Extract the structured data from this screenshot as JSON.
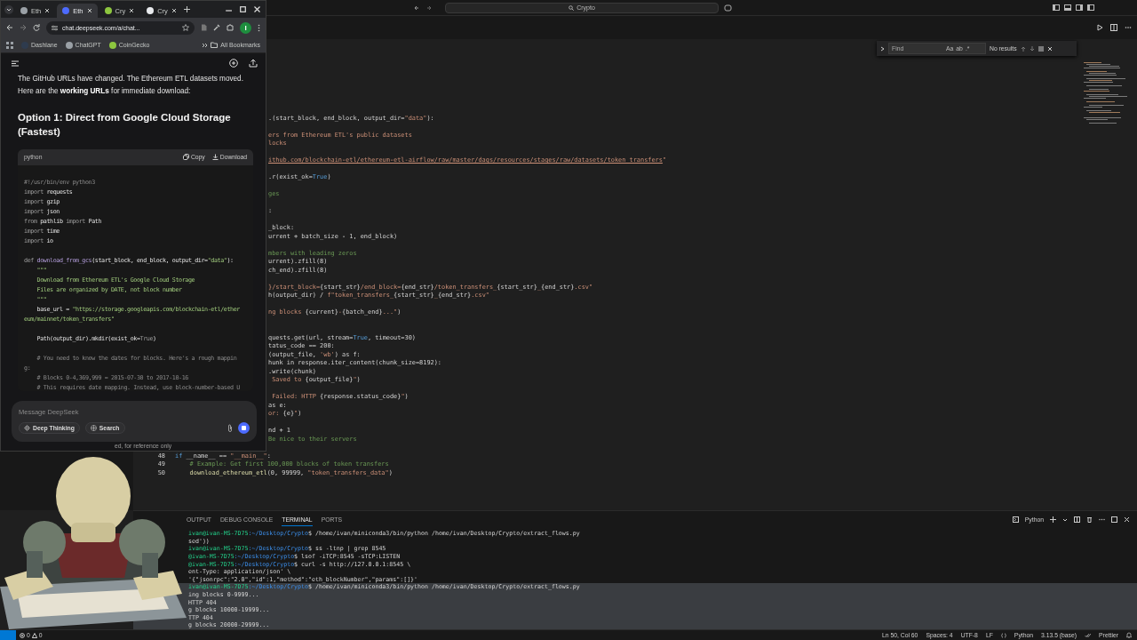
{
  "vscode": {
    "title": "Crypto",
    "find": {
      "placeholder": "Find",
      "options": [
        "Aa",
        "ab",
        ".*"
      ],
      "result": "No results"
    },
    "editor_lines": [
      {
        "kind": "blank"
      },
      {
        "kind": "blank"
      },
      {
        "kind": "blank"
      },
      {
        "kind": "blank"
      },
      {
        "kind": "blank"
      },
      {
        "kind": "blank"
      },
      {
        "kind": "blank"
      },
      {
        "kind": "cut",
        "segments": [
          {
            "kind": "plain",
            "text": ".(start_block, end_block, output_dir="
          },
          {
            "kind": "string",
            "text": "\"data\""
          },
          {
            "kind": "plain",
            "text": "):"
          }
        ]
      },
      {
        "kind": "blank"
      },
      {
        "kind": "cut",
        "segments": [
          {
            "kind": "string",
            "text": "ers from Ethereum ETL's public datasets"
          }
        ]
      },
      {
        "kind": "cut",
        "segments": [
          {
            "kind": "string",
            "text": "locks"
          }
        ]
      },
      {
        "kind": "blank"
      },
      {
        "kind": "cut",
        "segments": [
          {
            "kind": "link",
            "text": "ithub.com/blockchain-etl/ethereum-etl-airflow/raw/master/dags/resources/stages/raw/datasets/token_transfers"
          },
          {
            "kind": "string",
            "text": "\""
          }
        ]
      },
      {
        "kind": "blank"
      },
      {
        "kind": "cut",
        "segments": [
          {
            "kind": "plain",
            "text": ".r(exist_ok="
          },
          {
            "kind": "keyword",
            "text": "True"
          },
          {
            "kind": "plain",
            "text": ")"
          }
        ]
      },
      {
        "kind": "blank"
      },
      {
        "kind": "cut",
        "segments": [
          {
            "kind": "comment",
            "text": "ges"
          }
        ]
      },
      {
        "kind": "blank"
      },
      {
        "kind": "cut",
        "segments": [
          {
            "kind": "plain",
            "text": ":"
          }
        ]
      },
      {
        "kind": "blank"
      },
      {
        "kind": "cut",
        "segments": [
          {
            "kind": "plain",
            "text": "_block:"
          }
        ]
      },
      {
        "kind": "cut",
        "segments": [
          {
            "kind": "plain",
            "text": "urrent + batch_size - 1, end_block)"
          }
        ]
      },
      {
        "kind": "blank"
      },
      {
        "kind": "cut",
        "segments": [
          {
            "kind": "comment",
            "text": "mbers with leading zeros"
          }
        ]
      },
      {
        "kind": "cut",
        "segments": [
          {
            "kind": "plain",
            "text": "urrent).zfill(8)"
          }
        ]
      },
      {
        "kind": "cut",
        "segments": [
          {
            "kind": "plain",
            "text": "ch_end).zfill(8)"
          }
        ]
      },
      {
        "kind": "blank"
      },
      {
        "kind": "cut",
        "segments": [
          {
            "kind": "string",
            "text": "}/start_block="
          },
          {
            "kind": "plain",
            "text": "{start_str}"
          },
          {
            "kind": "string",
            "text": "/end_block="
          },
          {
            "kind": "plain",
            "text": "{end_str}"
          },
          {
            "kind": "string",
            "text": "/token_transfers_"
          },
          {
            "kind": "plain",
            "text": "{start_str}"
          },
          {
            "kind": "string",
            "text": "_"
          },
          {
            "kind": "plain",
            "text": "{end_str}"
          },
          {
            "kind": "string",
            "text": ".csv\""
          }
        ]
      },
      {
        "kind": "cut",
        "segments": [
          {
            "kind": "plain",
            "text": "h(output_dir) / "
          },
          {
            "kind": "string",
            "text": "f\"token_transfers_"
          },
          {
            "kind": "plain",
            "text": "{start_str}"
          },
          {
            "kind": "string",
            "text": "_"
          },
          {
            "kind": "plain",
            "text": "{end_str}"
          },
          {
            "kind": "string",
            "text": ".csv\""
          }
        ]
      },
      {
        "kind": "blank"
      },
      {
        "kind": "cut",
        "segments": [
          {
            "kind": "string",
            "text": "ng blocks "
          },
          {
            "kind": "plain",
            "text": "{current}"
          },
          {
            "kind": "string",
            "text": "-"
          },
          {
            "kind": "plain",
            "text": "{batch_end}"
          },
          {
            "kind": "string",
            "text": "...\""
          },
          {
            "kind": "plain",
            "text": ")"
          }
        ]
      },
      {
        "kind": "blank"
      },
      {
        "kind": "blank"
      },
      {
        "kind": "cut",
        "segments": [
          {
            "kind": "plain",
            "text": "quests.get(url, stream="
          },
          {
            "kind": "keyword",
            "text": "True"
          },
          {
            "kind": "plain",
            "text": ", timeout=30)"
          }
        ]
      },
      {
        "kind": "cut",
        "segments": [
          {
            "kind": "plain",
            "text": "tatus_code == 200:"
          }
        ]
      },
      {
        "kind": "cut",
        "segments": [
          {
            "kind": "plain",
            "text": "(output_file, "
          },
          {
            "kind": "string",
            "text": "'wb'"
          },
          {
            "kind": "plain",
            "text": ") as f:"
          }
        ]
      },
      {
        "kind": "cut",
        "segments": [
          {
            "kind": "plain",
            "text": "hunk in response.iter_content(chunk_size=8192):"
          }
        ]
      },
      {
        "kind": "cut",
        "segments": [
          {
            "kind": "plain",
            "text": ".write(chunk)"
          }
        ]
      },
      {
        "kind": "cut",
        "segments": [
          {
            "kind": "string",
            "text": " Saved to "
          },
          {
            "kind": "plain",
            "text": "{output_file}"
          },
          {
            "kind": "string",
            "text": "\""
          },
          {
            "kind": "plain",
            "text": ")"
          }
        ]
      },
      {
        "kind": "blank"
      },
      {
        "kind": "cut",
        "segments": [
          {
            "kind": "string",
            "text": " Failed: HTTP "
          },
          {
            "kind": "plain",
            "text": "{response.status_code}"
          },
          {
            "kind": "string",
            "text": "\""
          },
          {
            "kind": "plain",
            "text": ")"
          }
        ]
      },
      {
        "kind": "cut",
        "segments": [
          {
            "kind": "plain",
            "text": "as e:"
          }
        ]
      },
      {
        "kind": "cut",
        "segments": [
          {
            "kind": "string",
            "text": "or: "
          },
          {
            "kind": "plain",
            "text": "{e}"
          },
          {
            "kind": "string",
            "text": "\""
          },
          {
            "kind": "plain",
            "text": ")"
          }
        ]
      },
      {
        "kind": "blank"
      },
      {
        "kind": "cut",
        "segments": [
          {
            "kind": "plain",
            "text": "nd + 1"
          }
        ]
      },
      {
        "kind": "cut",
        "segments": [
          {
            "kind": "comment",
            "text": "Be nice to their servers"
          }
        ]
      },
      {
        "kind": "blank"
      },
      {
        "kind": "code",
        "number": "48",
        "segments": [
          {
            "kind": "keyword",
            "text": "if"
          },
          {
            "kind": "plain",
            "text": " __name__ == "
          },
          {
            "kind": "string",
            "text": "\"__main__\""
          },
          {
            "kind": "plain",
            "text": ":"
          }
        ]
      },
      {
        "kind": "code",
        "number": "49",
        "segments": [
          {
            "kind": "comment",
            "text": "    # Example: Get first 100,000 blocks of token transfers"
          }
        ]
      },
      {
        "kind": "code",
        "number": "50",
        "segments": [
          {
            "kind": "function",
            "text": "    download_ethereum_etl"
          },
          {
            "kind": "plain",
            "text": "(0, 99999, "
          },
          {
            "kind": "string",
            "text": "\"token_transfers_data\""
          },
          {
            "kind": "plain",
            "text": ")"
          }
        ]
      }
    ],
    "panel_tabs": [
      {
        "label": "OUTPUT",
        "selected": false
      },
      {
        "label": "DEBUG CONSOLE",
        "selected": false
      },
      {
        "label": "TERMINAL",
        "selected": true
      },
      {
        "label": "PORTS",
        "selected": false
      }
    ],
    "terminal_name": "Python",
    "terminal_lines": [
      {
        "selected": false,
        "segments": [
          {
            "kind": "user",
            "text": "ivan@ivan-MS-7D75"
          },
          {
            "kind": "path",
            "text": ":~/Desktop/Crypto"
          },
          {
            "kind": "plain",
            "text": "$ /home/ivan/miniconda3/bin/python /home/ivan/Desktop/Crypto/extract_flows.py"
          }
        ]
      },
      {
        "selected": false,
        "segments": [
          {
            "kind": "plain",
            "text": "sed'))"
          }
        ]
      },
      {
        "selected": false,
        "segments": [
          {
            "kind": "user",
            "text": "ivan@ivan-MS-7D75"
          },
          {
            "kind": "path",
            "text": ":~/Desktop/Crypto"
          },
          {
            "kind": "plain",
            "text": "$ ss -ltnp | grep 8545"
          }
        ]
      },
      {
        "selected": false,
        "segments": [
          {
            "kind": "user",
            "text": "@ivan-MS-7D75"
          },
          {
            "kind": "path",
            "text": ":~/Desktop/Crypto"
          },
          {
            "kind": "plain",
            "text": "$ lsof -iTCP:8545 -sTCP:LISTEN"
          }
        ]
      },
      {
        "selected": false,
        "segments": [
          {
            "kind": "user",
            "text": "@ivan-MS-7D75"
          },
          {
            "kind": "path",
            "text": ":~/Desktop/Crypto"
          },
          {
            "kind": "plain",
            "text": "$ curl -s http://127.0.0.1:8545 \\"
          }
        ]
      },
      {
        "selected": false,
        "segments": [
          {
            "kind": "plain",
            "text": "ent-Type: application/json' \\"
          }
        ]
      },
      {
        "selected": false,
        "segments": [
          {
            "kind": "plain",
            "text": "'{\"jsonrpc\":\"2.0\",\"id\":1,\"method\":\"eth_blockNumber\",\"params\":[]}'"
          }
        ]
      },
      {
        "selected": true,
        "segments": [
          {
            "kind": "user",
            "text": "ivan@ivan-MS-7D75"
          },
          {
            "kind": "path",
            "text": ":~/Desktop/Crypto"
          },
          {
            "kind": "plain",
            "text": "$ /home/ivan/miniconda3/bin/python /home/ivan/Desktop/Crypto/extract_flows.py"
          }
        ]
      },
      {
        "selected": true,
        "segments": [
          {
            "kind": "plain",
            "text": "ing blocks 0-9999..."
          }
        ]
      },
      {
        "selected": true,
        "segments": [
          {
            "kind": "plain",
            "text": "HTTP 404"
          }
        ]
      },
      {
        "selected": true,
        "segments": [
          {
            "kind": "plain",
            "text": "g blocks 10000-19999..."
          }
        ]
      },
      {
        "selected": true,
        "segments": [
          {
            "kind": "plain",
            "text": "TTP 404"
          }
        ]
      },
      {
        "selected": true,
        "segments": [
          {
            "kind": "plain",
            "text": "g blocks 20000-29999..."
          }
        ]
      }
    ],
    "status_left": {
      "errors": "0",
      "warnings": "0"
    },
    "status_right": [
      {
        "kind": "text",
        "label": "Ln 50, Col 60"
      },
      {
        "kind": "text",
        "label": "Spaces: 4"
      },
      {
        "kind": "text",
        "label": "UTF-8"
      },
      {
        "kind": "text",
        "label": "LF"
      },
      {
        "kind": "language",
        "label": "Python"
      },
      {
        "kind": "text",
        "label": "3.13.5 (base)"
      },
      {
        "kind": "formatter",
        "label": "Prettier"
      }
    ]
  },
  "browser": {
    "tabs": [
      {
        "label": "Eth",
        "selected": false,
        "color": "#9aa0a6"
      },
      {
        "label": "Eth",
        "selected": true,
        "color": "#4d6bfe"
      },
      {
        "label": "Cry",
        "selected": false,
        "color": "#8dc63f"
      },
      {
        "label": "Cry",
        "selected": false,
        "color": "#e8eaed"
      }
    ],
    "address": "chat.deepseek.com/a/chat...",
    "profile": "I",
    "bookmarks": [
      {
        "label": "Dashlane",
        "color": "#2e3b4e"
      },
      {
        "label": "ChatGPT",
        "color": "#9aa0a6"
      },
      {
        "label": "CoinGecko",
        "color": "#8dc63f"
      }
    ],
    "all_bookmarks": "All Bookmarks",
    "chat": {
      "paragraph": "The GitHub URLs have changed. The Ethereum ETL datasets moved. Here are the **working URLs** for immediate download:",
      "heading": "Option 1: Direct from Google Cloud Storage (Fastest)",
      "code_block": {
        "language": "python",
        "copy": "Copy",
        "download": "Download",
        "lines": [
          {
            "kind": "code",
            "segments": [
              {
                "kind": "comment",
                "text": "#!/usr/bin/env python3"
              }
            ]
          },
          {
            "kind": "code",
            "segments": [
              {
                "kind": "keyword",
                "text": "import"
              },
              {
                "kind": "plain",
                "text": " requests"
              }
            ]
          },
          {
            "kind": "code",
            "segments": [
              {
                "kind": "keyword",
                "text": "import"
              },
              {
                "kind": "plain",
                "text": " gzip"
              }
            ]
          },
          {
            "kind": "code",
            "segments": [
              {
                "kind": "keyword",
                "text": "import"
              },
              {
                "kind": "plain",
                "text": " json"
              }
            ]
          },
          {
            "kind": "code",
            "segments": [
              {
                "kind": "keyword",
                "text": "from"
              },
              {
                "kind": "plain",
                "text": " pathlib "
              },
              {
                "kind": "keyword",
                "text": "import"
              },
              {
                "kind": "plain",
                "text": " Path"
              }
            ]
          },
          {
            "kind": "code",
            "segments": [
              {
                "kind": "keyword",
                "text": "import"
              },
              {
                "kind": "plain",
                "text": " time"
              }
            ]
          },
          {
            "kind": "code",
            "segments": [
              {
                "kind": "keyword",
                "text": "import"
              },
              {
                "kind": "plain",
                "text": " io"
              }
            ]
          },
          {
            "kind": "blank"
          },
          {
            "kind": "code",
            "segments": [
              {
                "kind": "keyword",
                "text": "def"
              },
              {
                "kind": "function",
                "text": " download_from_gcs"
              },
              {
                "kind": "plain",
                "text": "(start_block, end_block, output_dir="
              },
              {
                "kind": "string",
                "text": "\"data\""
              },
              {
                "kind": "plain",
                "text": "):"
              }
            ]
          },
          {
            "kind": "code",
            "segments": [
              {
                "kind": "string",
                "text": "    \"\"\""
              }
            ]
          },
          {
            "kind": "code",
            "segments": [
              {
                "kind": "string",
                "text": "    Download from Ethereum ETL's Google Cloud Storage"
              }
            ]
          },
          {
            "kind": "code",
            "segments": [
              {
                "kind": "string",
                "text": "    Files are organized by DATE, not block number"
              }
            ]
          },
          {
            "kind": "code",
            "segments": [
              {
                "kind": "string",
                "text": "    \"\"\""
              }
            ]
          },
          {
            "kind": "code",
            "segments": [
              {
                "kind": "plain",
                "text": "    base_url = "
              },
              {
                "kind": "string",
                "text": "\"https://storage.googleapis.com/blockchain-etl/ether"
              }
            ]
          },
          {
            "kind": "code",
            "segments": [
              {
                "kind": "string",
                "text": "eum/mainnet/token_transfers\""
              }
            ]
          },
          {
            "kind": "blank"
          },
          {
            "kind": "code",
            "segments": [
              {
                "kind": "plain",
                "text": "    Path(output_dir).mkdir(exist_ok="
              },
              {
                "kind": "keyword",
                "text": "True"
              },
              {
                "kind": "plain",
                "text": ")"
              }
            ]
          },
          {
            "kind": "blank"
          },
          {
            "kind": "code",
            "segments": [
              {
                "kind": "comment",
                "text": "    # You need to know the dates for blocks. Here's a rough mappin"
              }
            ]
          },
          {
            "kind": "code",
            "segments": [
              {
                "kind": "comment",
                "text": "g:"
              }
            ]
          },
          {
            "kind": "code",
            "segments": [
              {
                "kind": "comment",
                "text": "    # Blocks 0-4,369,999 = 2015-07-30 to 2017-10-16"
              }
            ]
          },
          {
            "kind": "code",
            "segments": [
              {
                "kind": "comment",
                "text": "    # This requires date mapping. Instead, use block-number-based U"
              }
            ]
          }
        ]
      },
      "composer": {
        "placeholder": "Message DeepSeek",
        "buttons": [
          {
            "kind": "thinking",
            "label": "Deep Thinking",
            "selected": false
          },
          {
            "kind": "search",
            "label": "Search",
            "selected": false
          }
        ]
      },
      "disclaimer": "ed, for reference only"
    }
  }
}
